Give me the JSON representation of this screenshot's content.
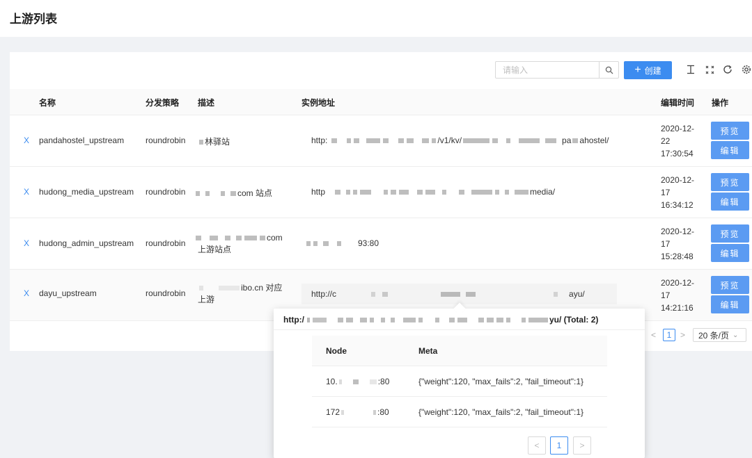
{
  "page": {
    "title": "上游列表"
  },
  "toolbar": {
    "search_placeholder": "请输入",
    "create_label": "创建",
    "icons": [
      "column-height-icon",
      "fullscreen-icon",
      "reload-icon",
      "settings-icon"
    ]
  },
  "table": {
    "columns": [
      "名称",
      "分发策略",
      "描述",
      "实例地址",
      "编辑时间",
      "操作"
    ],
    "expand_symbol": "X",
    "rows": [
      {
        "name": "pandahostel_upstream",
        "strategy": "roundrobin",
        "desc": "林驿站",
        "desc2": "",
        "addr_pre": "http:",
        "addr_tail1": "/v1/kv/",
        "addr_tail2": "pa",
        "addr_tail3": "ahostel/",
        "time": [
          "2020-12-",
          "22",
          "17:30:54"
        ]
      },
      {
        "name": "hudong_media_upstream",
        "strategy": "roundrobin",
        "desc": "com 站点",
        "desc2": "",
        "addr_pre": "http",
        "addr_tail1": "",
        "addr_tail2": "",
        "addr_tail3": "media/",
        "time": [
          "2020-12-",
          "17",
          "16:34:12"
        ]
      },
      {
        "name": "hudong_admin_upstream",
        "strategy": "roundrobin",
        "desc": "com",
        "desc2": "上游站点",
        "addr_pre": "",
        "addr_tail1": "93:80",
        "addr_tail2": "",
        "addr_tail3": "",
        "time": [
          "2020-12-",
          "17",
          "15:28:48"
        ]
      },
      {
        "name": "dayu_upstream",
        "strategy": "roundrobin",
        "desc": "ibo.cn 对应",
        "desc2": "上游",
        "addr_pre": "http://c",
        "addr_tail1": "",
        "addr_tail2": "",
        "addr_tail3": "ayu/",
        "time": [
          "2020-12-",
          "17",
          "14:21:16"
        ]
      }
    ],
    "actions": {
      "preview": "预览",
      "edit": "编辑"
    }
  },
  "pagination": {
    "prev": "<",
    "current": "1",
    "next": ">",
    "page_size": "20 条/页"
  },
  "popover": {
    "title_prefix": "http:/",
    "title_suffix": "yu/ (Total: 2)",
    "columns": [
      "Node",
      "Meta"
    ],
    "rows": [
      {
        "node_a": "10.",
        "node_b": ":80",
        "meta": "{\"weight\":120, \"max_fails\":2, \"fail_timeout\":1}"
      },
      {
        "node_a": "172",
        "node_b": ":80",
        "meta": "{\"weight\":120, \"max_fails\":2, \"fail_timeout\":1}"
      }
    ],
    "pager": {
      "prev": "<",
      "current": "1",
      "next": ">"
    }
  },
  "colors": {
    "primary": "#3c8cf0",
    "button": "#5b9bf2",
    "background": "#f0f2f5"
  }
}
